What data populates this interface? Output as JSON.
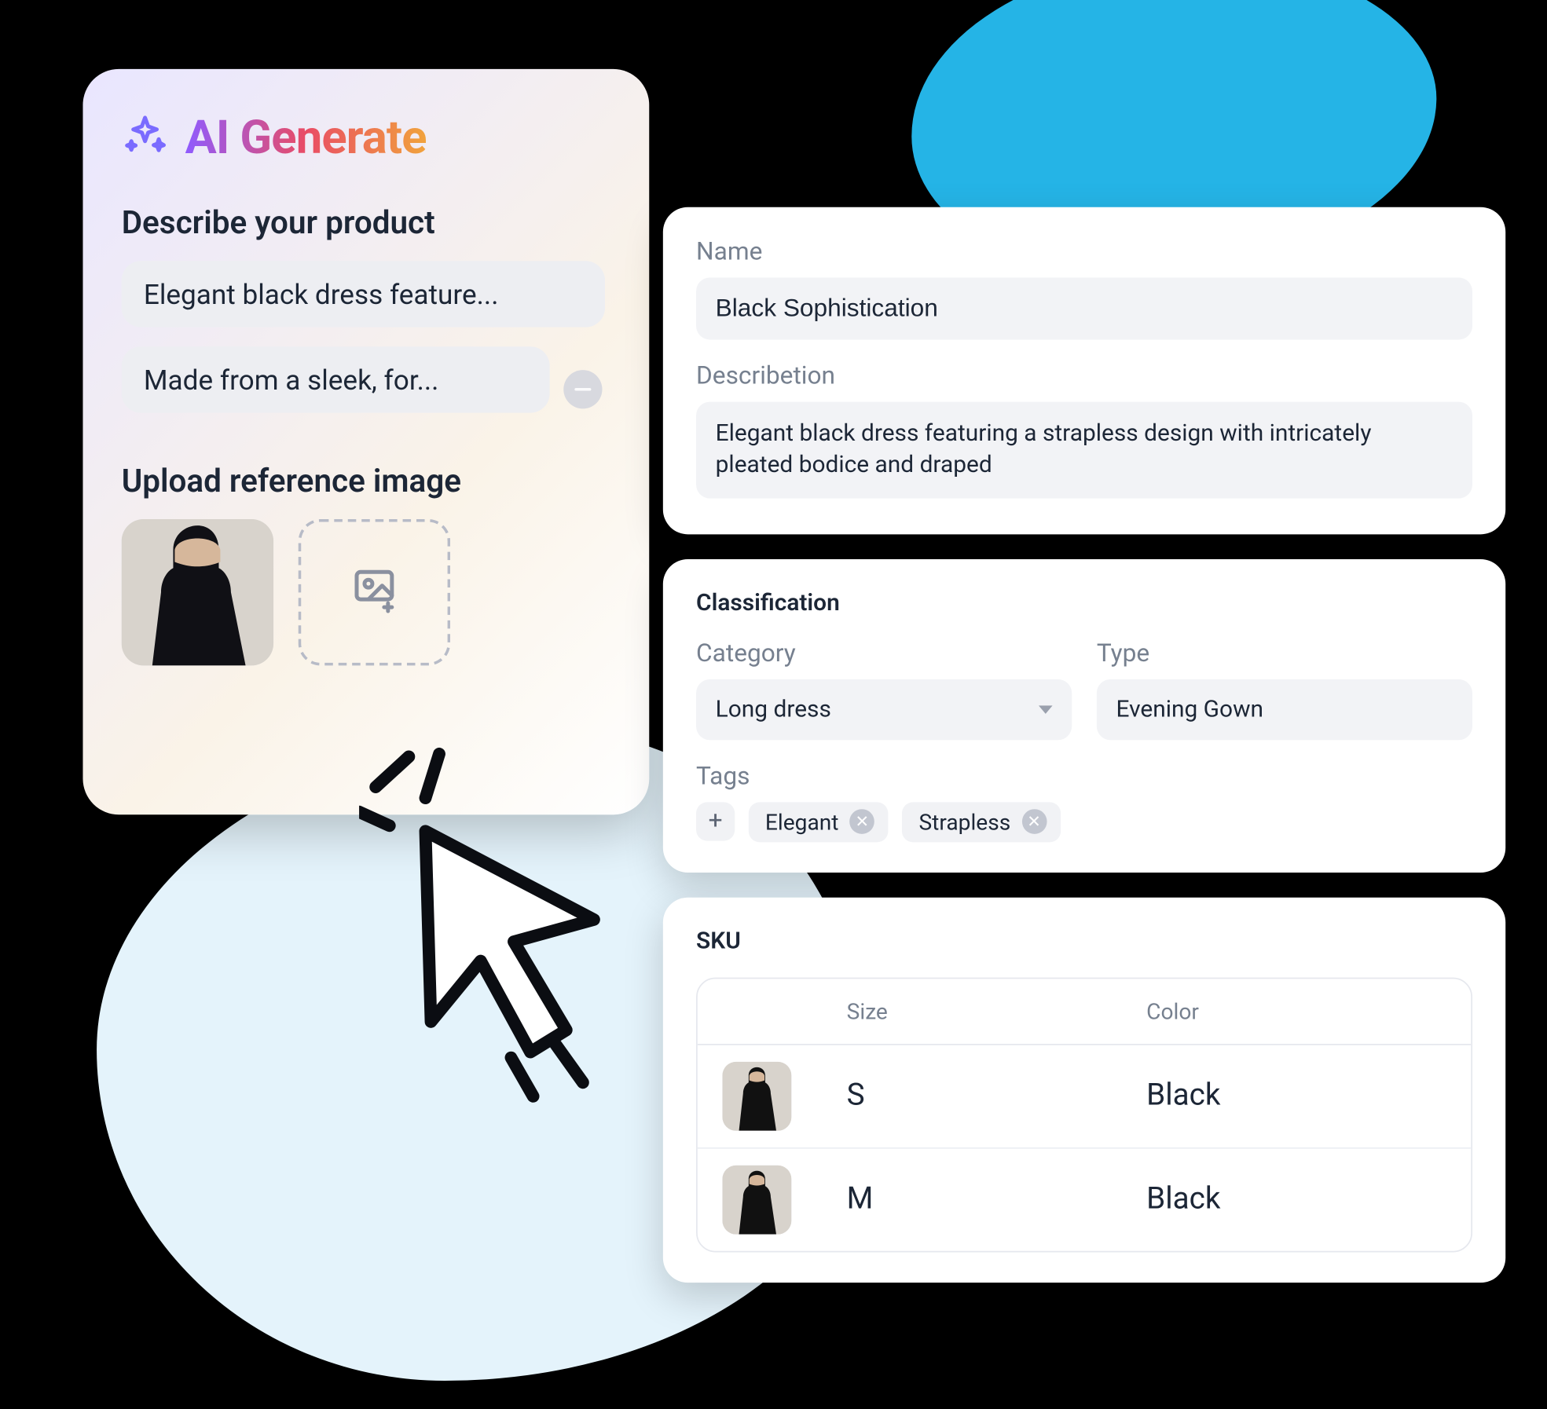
{
  "ai_panel": {
    "title": "AI Generate",
    "describe_heading": "Describe your product",
    "prompts": [
      "Elegant black dress feature...",
      "Made from a sleek, for..."
    ],
    "upload_heading": "Upload reference image"
  },
  "product": {
    "name_label": "Name",
    "name_value": "Black Sophistication",
    "description_label": "Describetion",
    "description_value": "Elegant black dress featuring a strapless design with intricately pleated bodice and draped"
  },
  "classification": {
    "section_label": "Classification",
    "category_label": "Category",
    "category_value": "Long dress",
    "type_label": "Type",
    "type_value": "Evening Gown",
    "tags_label": "Tags",
    "tags": [
      "Elegant",
      "Strapless"
    ]
  },
  "sku": {
    "section_label": "SKU",
    "head_size": "Size",
    "head_color": "Color",
    "rows": [
      {
        "size": "S",
        "color": "Black"
      },
      {
        "size": "M",
        "color": "Black"
      }
    ]
  }
}
